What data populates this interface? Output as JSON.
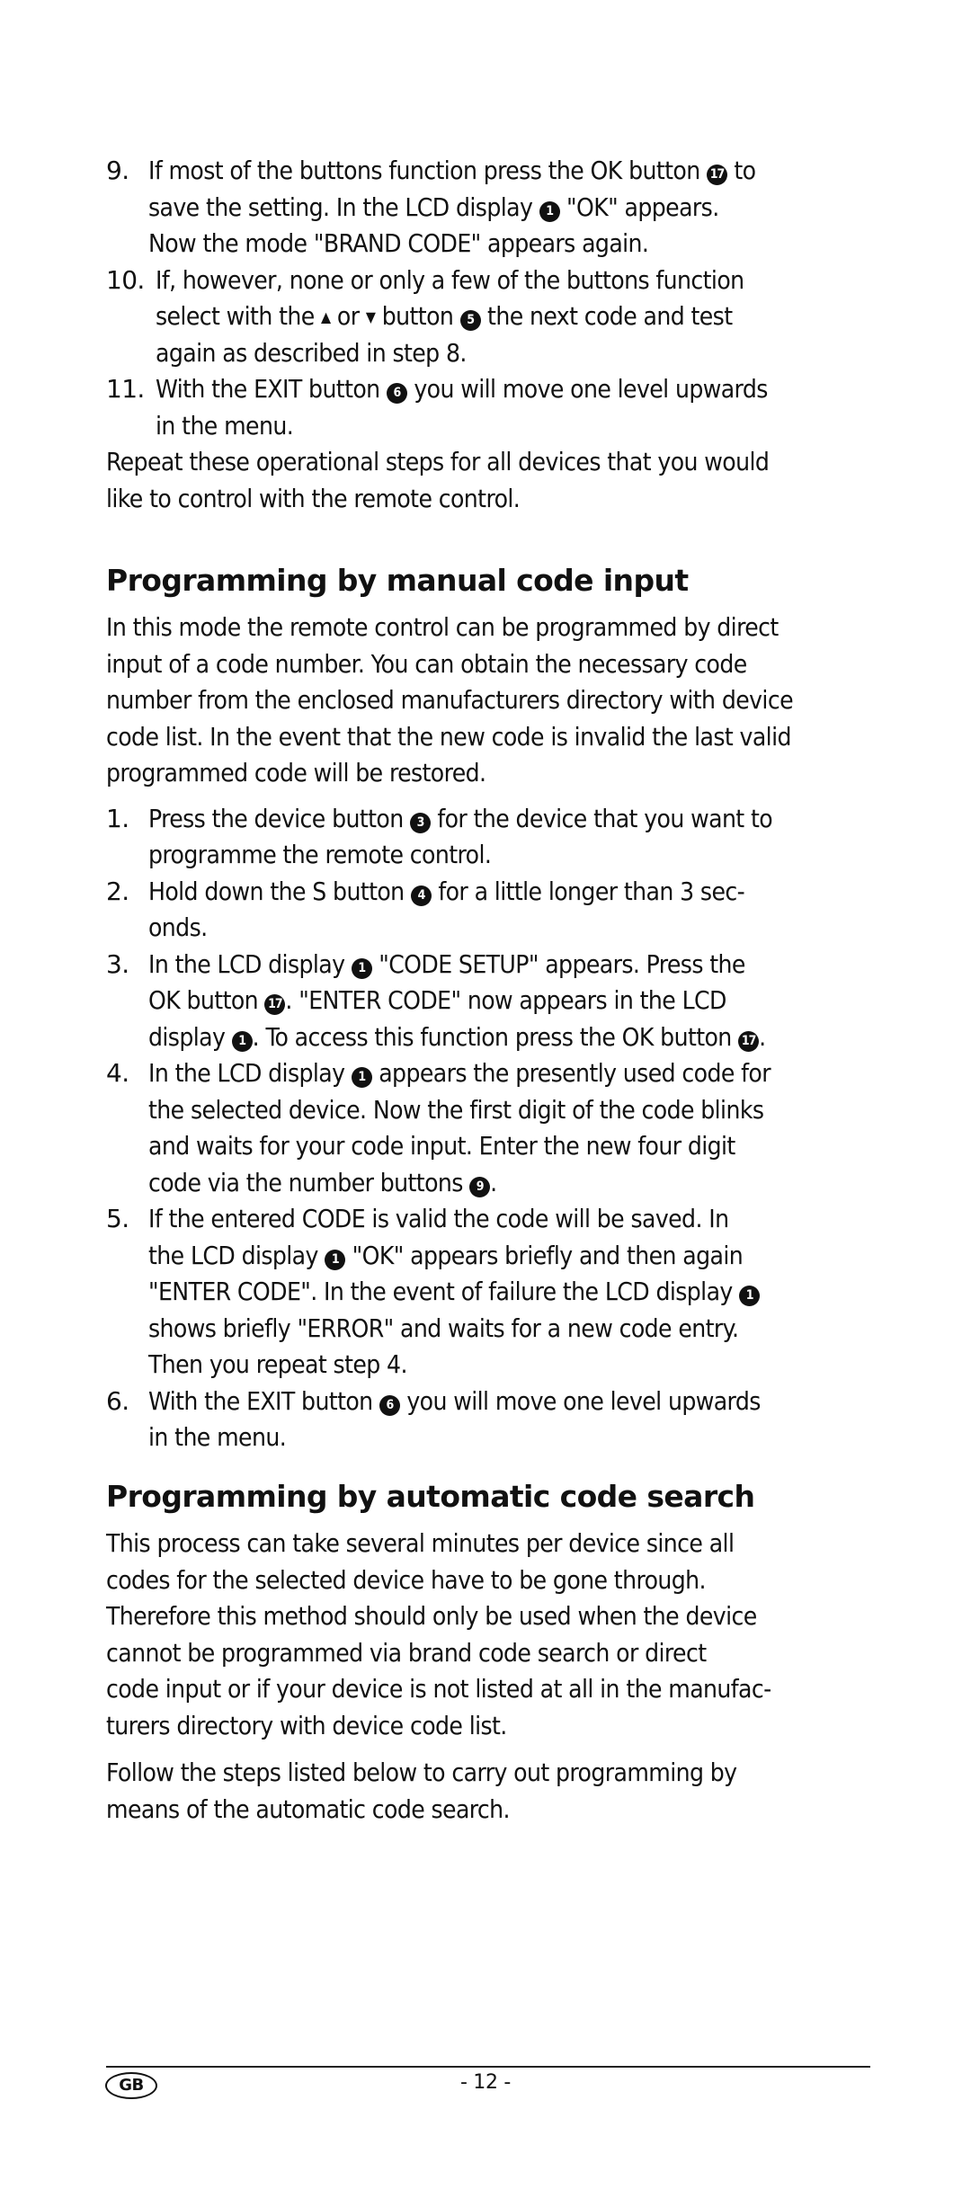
{
  "section_top": {
    "steps": [
      {
        "num": "9.",
        "lines": [
          [
            "If most of the buttons function press the OK button ",
            {
              "badge": "17"
            },
            " to"
          ],
          [
            "save the setting. In the LCD display ",
            {
              "badge": "1"
            },
            " \"OK\" appears."
          ],
          [
            "Now the mode \"BRAND CODE\" appears again."
          ]
        ]
      },
      {
        "num": "10.",
        "lines": [
          [
            "If, however, none or only a few of the buttons function"
          ],
          [
            "select with the ",
            {
              "icon": "up"
            },
            " or ",
            {
              "icon": "down"
            },
            " button ",
            {
              "badge": "5"
            },
            " the next code and test"
          ],
          [
            "again as described in step 8."
          ]
        ]
      },
      {
        "num": "11.",
        "lines": [
          [
            "With the EXIT button ",
            {
              "badge": "6"
            },
            " you will move one level upwards"
          ],
          [
            "in the menu."
          ]
        ]
      }
    ],
    "closing": [
      "Repeat these operational steps for all devices that you would",
      "like to control with the remote control."
    ]
  },
  "section_manual": {
    "heading": "Programming by manual code input",
    "intro": [
      "In this mode the remote control can be programmed by direct",
      "input of a code number. You can obtain the necessary code",
      "number from the enclosed manufacturers directory with device",
      "code list. In the event that the new code is invalid the last valid",
      "programmed code will be restored."
    ],
    "steps": [
      {
        "num": "1.",
        "lines": [
          [
            "Press the device button ",
            {
              "badge": "3"
            },
            " for the device that you want to"
          ],
          [
            "programme the remote control."
          ]
        ]
      },
      {
        "num": "2.",
        "lines": [
          [
            "Hold down the S button ",
            {
              "badge": "4"
            },
            " for a little longer than 3 sec-"
          ],
          [
            "onds."
          ]
        ]
      },
      {
        "num": "3.",
        "lines": [
          [
            "In the LCD display ",
            {
              "badge": "1"
            },
            " \"CODE SETUP\" appears. Press the"
          ],
          [
            "OK button ",
            {
              "badge": "17"
            },
            ".  \"ENTER CODE\" now appears in the LCD"
          ],
          [
            "display ",
            {
              "badge": "1"
            },
            ".  To access this function press the OK button ",
            {
              "badge": "17"
            },
            "."
          ]
        ]
      },
      {
        "num": "4.",
        "lines": [
          [
            "In the LCD display ",
            {
              "badge": "1"
            },
            " appears the presently used code for"
          ],
          [
            "the selected device. Now the first digit of the code blinks"
          ],
          [
            "and waits for your code input. Enter the new four digit"
          ],
          [
            "code via the number buttons ",
            {
              "badge": "9"
            },
            "."
          ]
        ]
      },
      {
        "num": "5.",
        "lines": [
          [
            "If the entered CODE is valid the code will be saved. In"
          ],
          [
            "the LCD display ",
            {
              "badge": "1"
            },
            " \"OK\" appears briefly and then again"
          ],
          [
            "\"ENTER CODE\". In the event of failure the LCD display ",
            {
              "badge": "1"
            }
          ],
          [
            "shows briefly \"ERROR\" and waits for a new code entry."
          ],
          [
            "Then you repeat step 4."
          ]
        ]
      },
      {
        "num": "6.",
        "lines": [
          [
            "With the EXIT button ",
            {
              "badge": "6"
            },
            " you will move one level upwards"
          ],
          [
            "in the menu."
          ]
        ]
      }
    ]
  },
  "section_auto": {
    "heading": "Programming by automatic code search",
    "intro": [
      "This process can take several minutes per device since all",
      "codes for the selected device have to be gone through.",
      "Therefore this method should only be used when the device",
      "cannot be programmed via brand code search or direct",
      "code input or if your device is not listed at all in the manufac-",
      "turers directory with device code list."
    ],
    "follow": [
      "Follow the steps listed below to carry out programming by",
      "means of the automatic code search."
    ]
  },
  "footer": {
    "country": "GB",
    "page": "- 12 -"
  }
}
